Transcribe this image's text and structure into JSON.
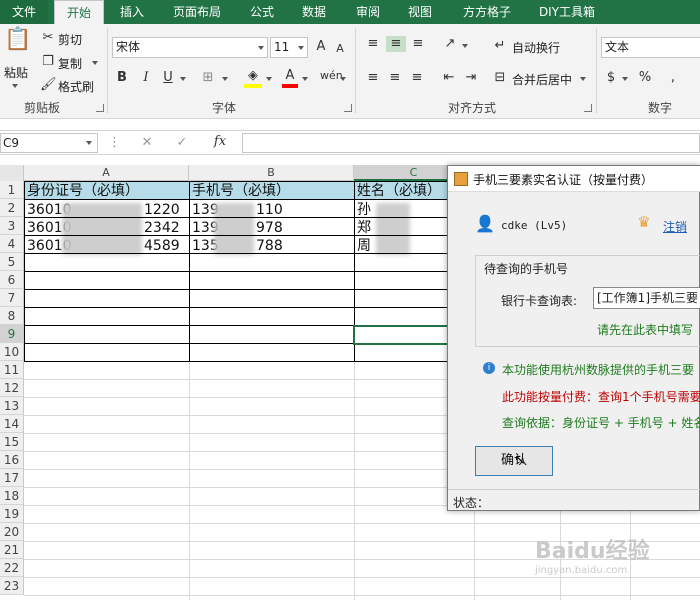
{
  "ribbon_tabs": [
    "文件",
    "开始",
    "插入",
    "页面布局",
    "公式",
    "数据",
    "审阅",
    "视图",
    "方方格子",
    "DIY工具箱"
  ],
  "ribbon": {
    "clipboard": {
      "paste": "粘贴",
      "cut": "剪切",
      "copy": "复制",
      "format_painter": "格式刷",
      "group_label": "剪贴板"
    },
    "font": {
      "font_name": "宋体",
      "font_size": "11",
      "group_label": "字体"
    },
    "alignment": {
      "wrap_text": "自动换行",
      "merge_center": "合并后居中",
      "group_label": "对齐方式"
    },
    "number": {
      "format": "文本",
      "group_label": "数字"
    }
  },
  "formula_bar": {
    "name_box": "C9",
    "fx": "fx",
    "formula": ""
  },
  "columns": [
    "A",
    "B",
    "C"
  ],
  "rows": [
    "1",
    "2",
    "3",
    "4",
    "5",
    "6",
    "7",
    "8",
    "9",
    "10",
    "11",
    "12",
    "13",
    "14",
    "15",
    "16",
    "17",
    "18",
    "19",
    "20",
    "21",
    "22",
    "23"
  ],
  "table": {
    "headers": [
      "身份证号（必填）",
      "手机号（必填）",
      "姓名（必填）"
    ],
    "rows": [
      {
        "id": "36010",
        "id_tail": "1220",
        "phone": "139",
        "phone_tail": "110",
        "name": "孙"
      },
      {
        "id": "36010",
        "id_tail": "2342",
        "phone": "139",
        "phone_tail": "978",
        "name": "郑"
      },
      {
        "id": "36010",
        "id_tail": "4589",
        "phone": "135",
        "phone_tail": "788",
        "name": "周"
      }
    ]
  },
  "dialog": {
    "title": "手机三要素实名认证（按量付费）",
    "user": "cdke (Lv5)",
    "logout": "注销",
    "section_title": "待查询的手机号",
    "bank_table_label": "银行卡查询表:",
    "bank_table_value": "[工作簿1]手机三要",
    "fill_hint": "请先在此表中填写",
    "info": "本功能使用杭州数脉提供的手机三要",
    "billing": "此功能按量付费：查询1个手机号需要",
    "basis": "查询依据：身份证号 + 手机号 + 姓名",
    "ok_button": "确认",
    "status_label": "状态："
  },
  "watermark": {
    "brand": "Baidu经验",
    "url": "jingyan.baidu.com"
  },
  "colors": {
    "excel_green": "#217346",
    "header_fill": "#b5dce8",
    "billing_red": "#c00000",
    "info_green": "#1e7b1e",
    "link_blue": "#1a5fb4"
  }
}
